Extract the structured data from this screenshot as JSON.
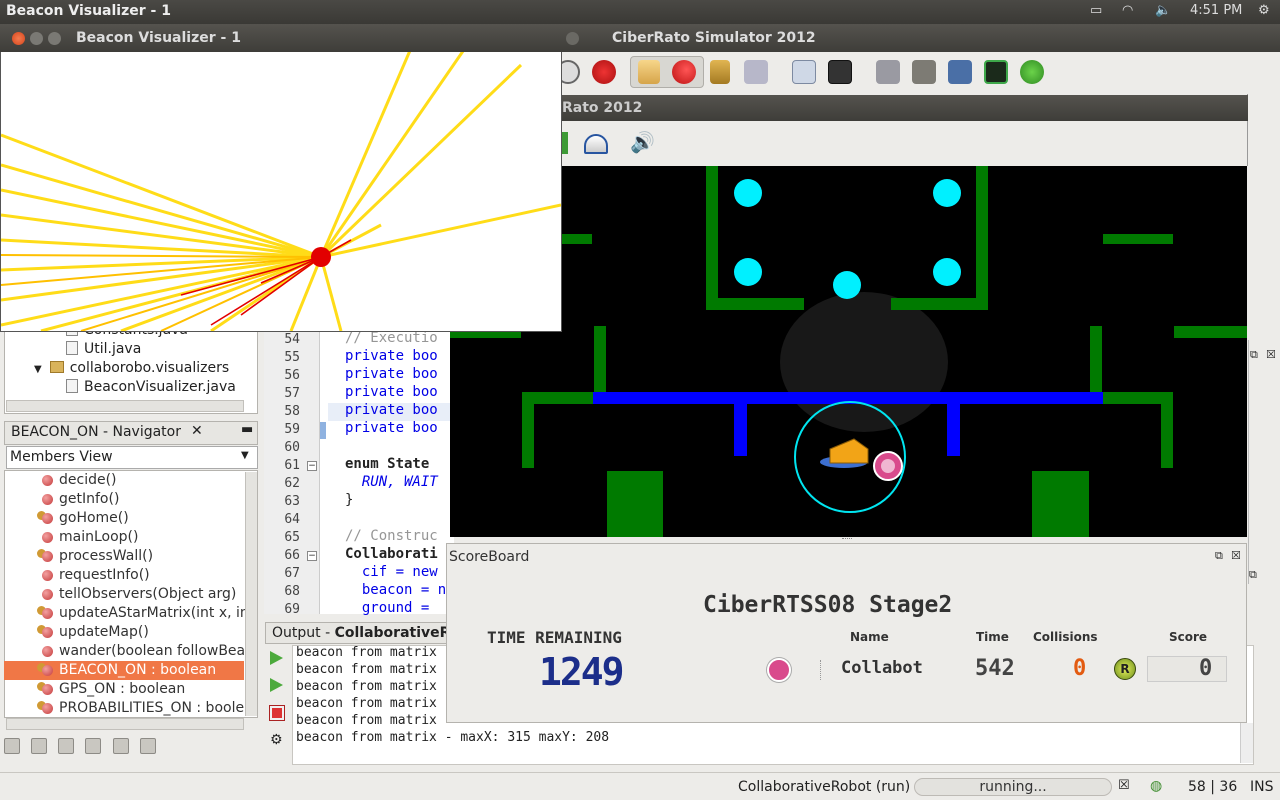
{
  "top_panel": {
    "app_title": "Beacon Visualizer - 1",
    "clock": "4:51 PM"
  },
  "simulator": {
    "window_title": "CiberRato Simulator 2012",
    "viewer_title": "Rato 2012"
  },
  "beacon_window": {
    "title": "Beacon Visualizer - 1"
  },
  "project_tree": {
    "items": [
      {
        "label": "Constants.java"
      },
      {
        "label": "Util.java"
      },
      {
        "label": "collaborobo.visualizers"
      },
      {
        "label": "BeaconVisualizer.java"
      }
    ]
  },
  "navigator": {
    "tab_label": "BEACON_ON - Navigator",
    "view_select": "Members View",
    "members": [
      {
        "label": "decide()"
      },
      {
        "label": "getInfo()"
      },
      {
        "label": "goHome()"
      },
      {
        "label": "mainLoop()"
      },
      {
        "label": "processWall()"
      },
      {
        "label": "requestInfo()"
      },
      {
        "label": "tellObservers(Object arg)"
      },
      {
        "label": "updateAStarMatrix(int x, int"
      },
      {
        "label": "updateMap()"
      },
      {
        "label": "wander(boolean followBea"
      },
      {
        "label": "BEACON_ON : boolean"
      },
      {
        "label": "GPS_ON : boolean"
      },
      {
        "label": "PROBABILITIES_ON : boolea"
      }
    ]
  },
  "editor": {
    "lines": [
      {
        "num": "54",
        "code": "// Executio"
      },
      {
        "num": "55",
        "code": "private boo"
      },
      {
        "num": "56",
        "code": "private boo"
      },
      {
        "num": "57",
        "code": "private boo"
      },
      {
        "num": "58",
        "code": "private boo"
      },
      {
        "num": "59",
        "code": "private boo"
      },
      {
        "num": "60",
        "code": ""
      },
      {
        "num": "61",
        "code": "enum State"
      },
      {
        "num": "62",
        "code": "  RUN, WAIT"
      },
      {
        "num": "63",
        "code": "}"
      },
      {
        "num": "64",
        "code": ""
      },
      {
        "num": "65",
        "code": "// Construc"
      },
      {
        "num": "66",
        "code": "Collaborati"
      },
      {
        "num": "67",
        "code": "  cif = new"
      },
      {
        "num": "68",
        "code": "  beacon = n"
      },
      {
        "num": "69",
        "code": "  ground = "
      }
    ]
  },
  "output": {
    "tab_label": "Output - ",
    "tab_project": "CollaborativeRo",
    "lines": [
      "beacon from matrix",
      "beacon from matrix",
      "beacon from matrix",
      "beacon from matrix",
      "beacon from matrix",
      "beacon from matrix - maxX: 315  maxY: 208"
    ]
  },
  "scoreboard": {
    "panel_title": "ScoreBoard",
    "heading": "CiberRTSS08 Stage2",
    "time_remaining_label": "TIME REMAINING",
    "time_remaining": "1249",
    "col_name": "Name",
    "col_time": "Time",
    "col_collisions": "Collisions",
    "col_score": "Score",
    "robot_name": "Collabot",
    "robot_time": "542",
    "robot_collisions": "0",
    "returned_badge": "R",
    "robot_score": "0"
  },
  "status_bar": {
    "run_label": "CollaborativeRobot (run)",
    "progress_text": "running...",
    "cursor_pos": "58 | 36",
    "insert_mode": "INS"
  },
  "colors": {
    "wall": "#007a00",
    "beacon_area": "#0000ff",
    "target": "#00ffff",
    "highlight": "#f07746"
  }
}
